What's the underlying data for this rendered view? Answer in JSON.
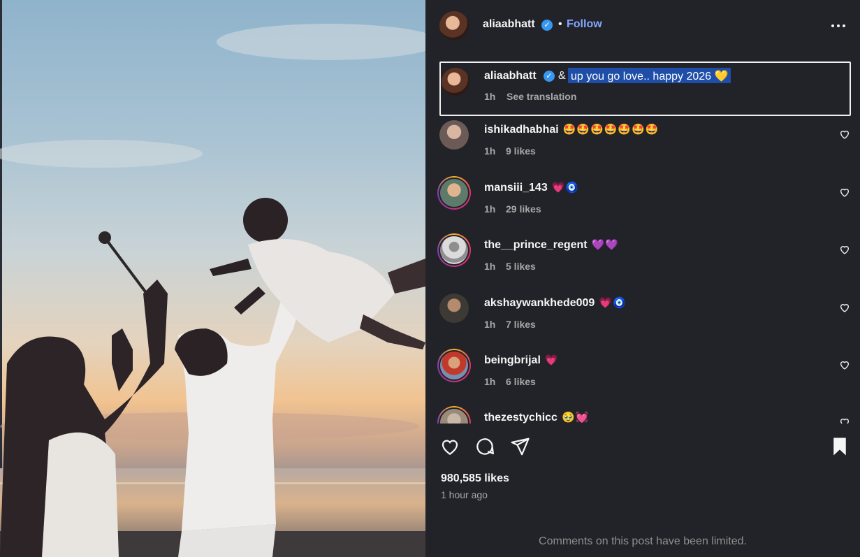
{
  "post": {
    "username": "aliaabhatt",
    "verified": true,
    "separator": "•",
    "follow_label": "Follow",
    "more_icon": "more-horizontal-icon"
  },
  "caption": {
    "username": "aliaabhatt",
    "prefix": "&",
    "text": "up you go love.. happy 2026 💛",
    "time": "1h",
    "see_translation": "See translation"
  },
  "comments": [
    {
      "username": "ishikadhabhai",
      "text": "🤩🤩🤩🤩🤩🤩🤩",
      "time": "1h",
      "likes": "9 likes",
      "avatar_color": "#6b5a55",
      "ring": false
    },
    {
      "username": "mansiii_143",
      "text": "💗🧿",
      "time": "1h",
      "likes": "29 likes",
      "avatar_color": "#5d7a6a",
      "ring": true
    },
    {
      "username": "the__prince_regent",
      "text": "💜💜",
      "time": "1h",
      "likes": "5 likes",
      "avatar_color": "#dbdbdb",
      "ring": true
    },
    {
      "username": "akshaywankhede009",
      "text": "💗🧿",
      "time": "1h",
      "likes": "7 likes",
      "avatar_color": "#3d3a36",
      "ring": false
    },
    {
      "username": "beingbrijal",
      "text": "💗",
      "time": "1h",
      "likes": "6 likes",
      "avatar_color": "#7a8fb0",
      "ring": true
    },
    {
      "username": "thezestychicc",
      "text": "🥹💓",
      "time": "",
      "likes": "",
      "avatar_color": "#9a8a7a",
      "ring": true
    }
  ],
  "actions": {
    "like_icon": "heart-outline-icon",
    "comment_icon": "comment-icon",
    "share_icon": "send-icon",
    "save_icon": "bookmark-filled-icon"
  },
  "likes": "980,585 likes",
  "posted": "1 hour ago",
  "comments_limited": "Comments on this post have been limited.",
  "colors": {
    "panel_bg": "#212329",
    "link": "#85a7ff",
    "verified": "#3897f0",
    "highlight": "#1e4ea8",
    "muted": "#a8a8a8"
  }
}
